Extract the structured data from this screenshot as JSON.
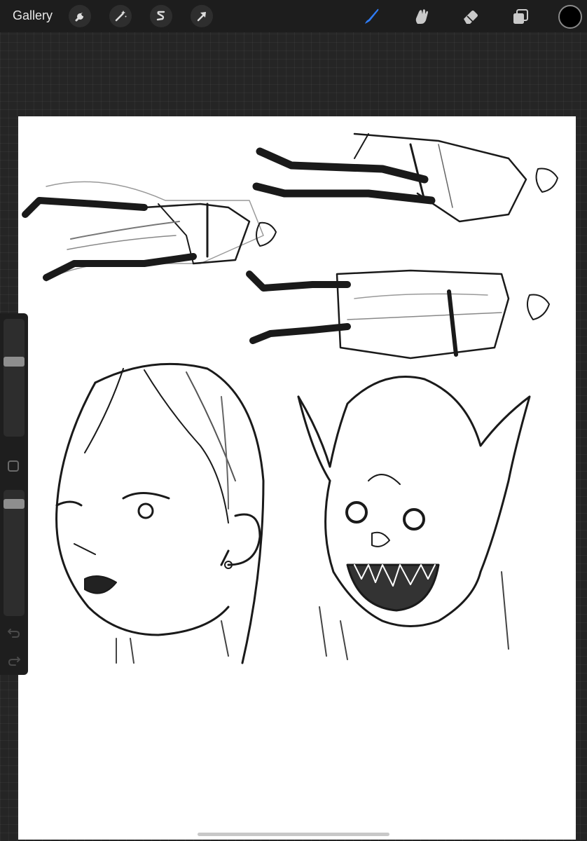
{
  "toolbar": {
    "gallery_label": "Gallery",
    "left_tools": [
      "wrench-icon",
      "magic-wand-icon",
      "selection-icon",
      "transform-arrow-icon"
    ],
    "right_tools": [
      "brush-icon",
      "smudge-icon",
      "eraser-icon",
      "layers-icon"
    ],
    "active_tool": "brush",
    "active_color": "#2f7cf6",
    "current_color": "#000000"
  },
  "sidebar": {
    "brush_size_level": 0.65,
    "opacity_level": 0.92,
    "buttons": [
      "undo-icon",
      "redo-icon"
    ]
  }
}
